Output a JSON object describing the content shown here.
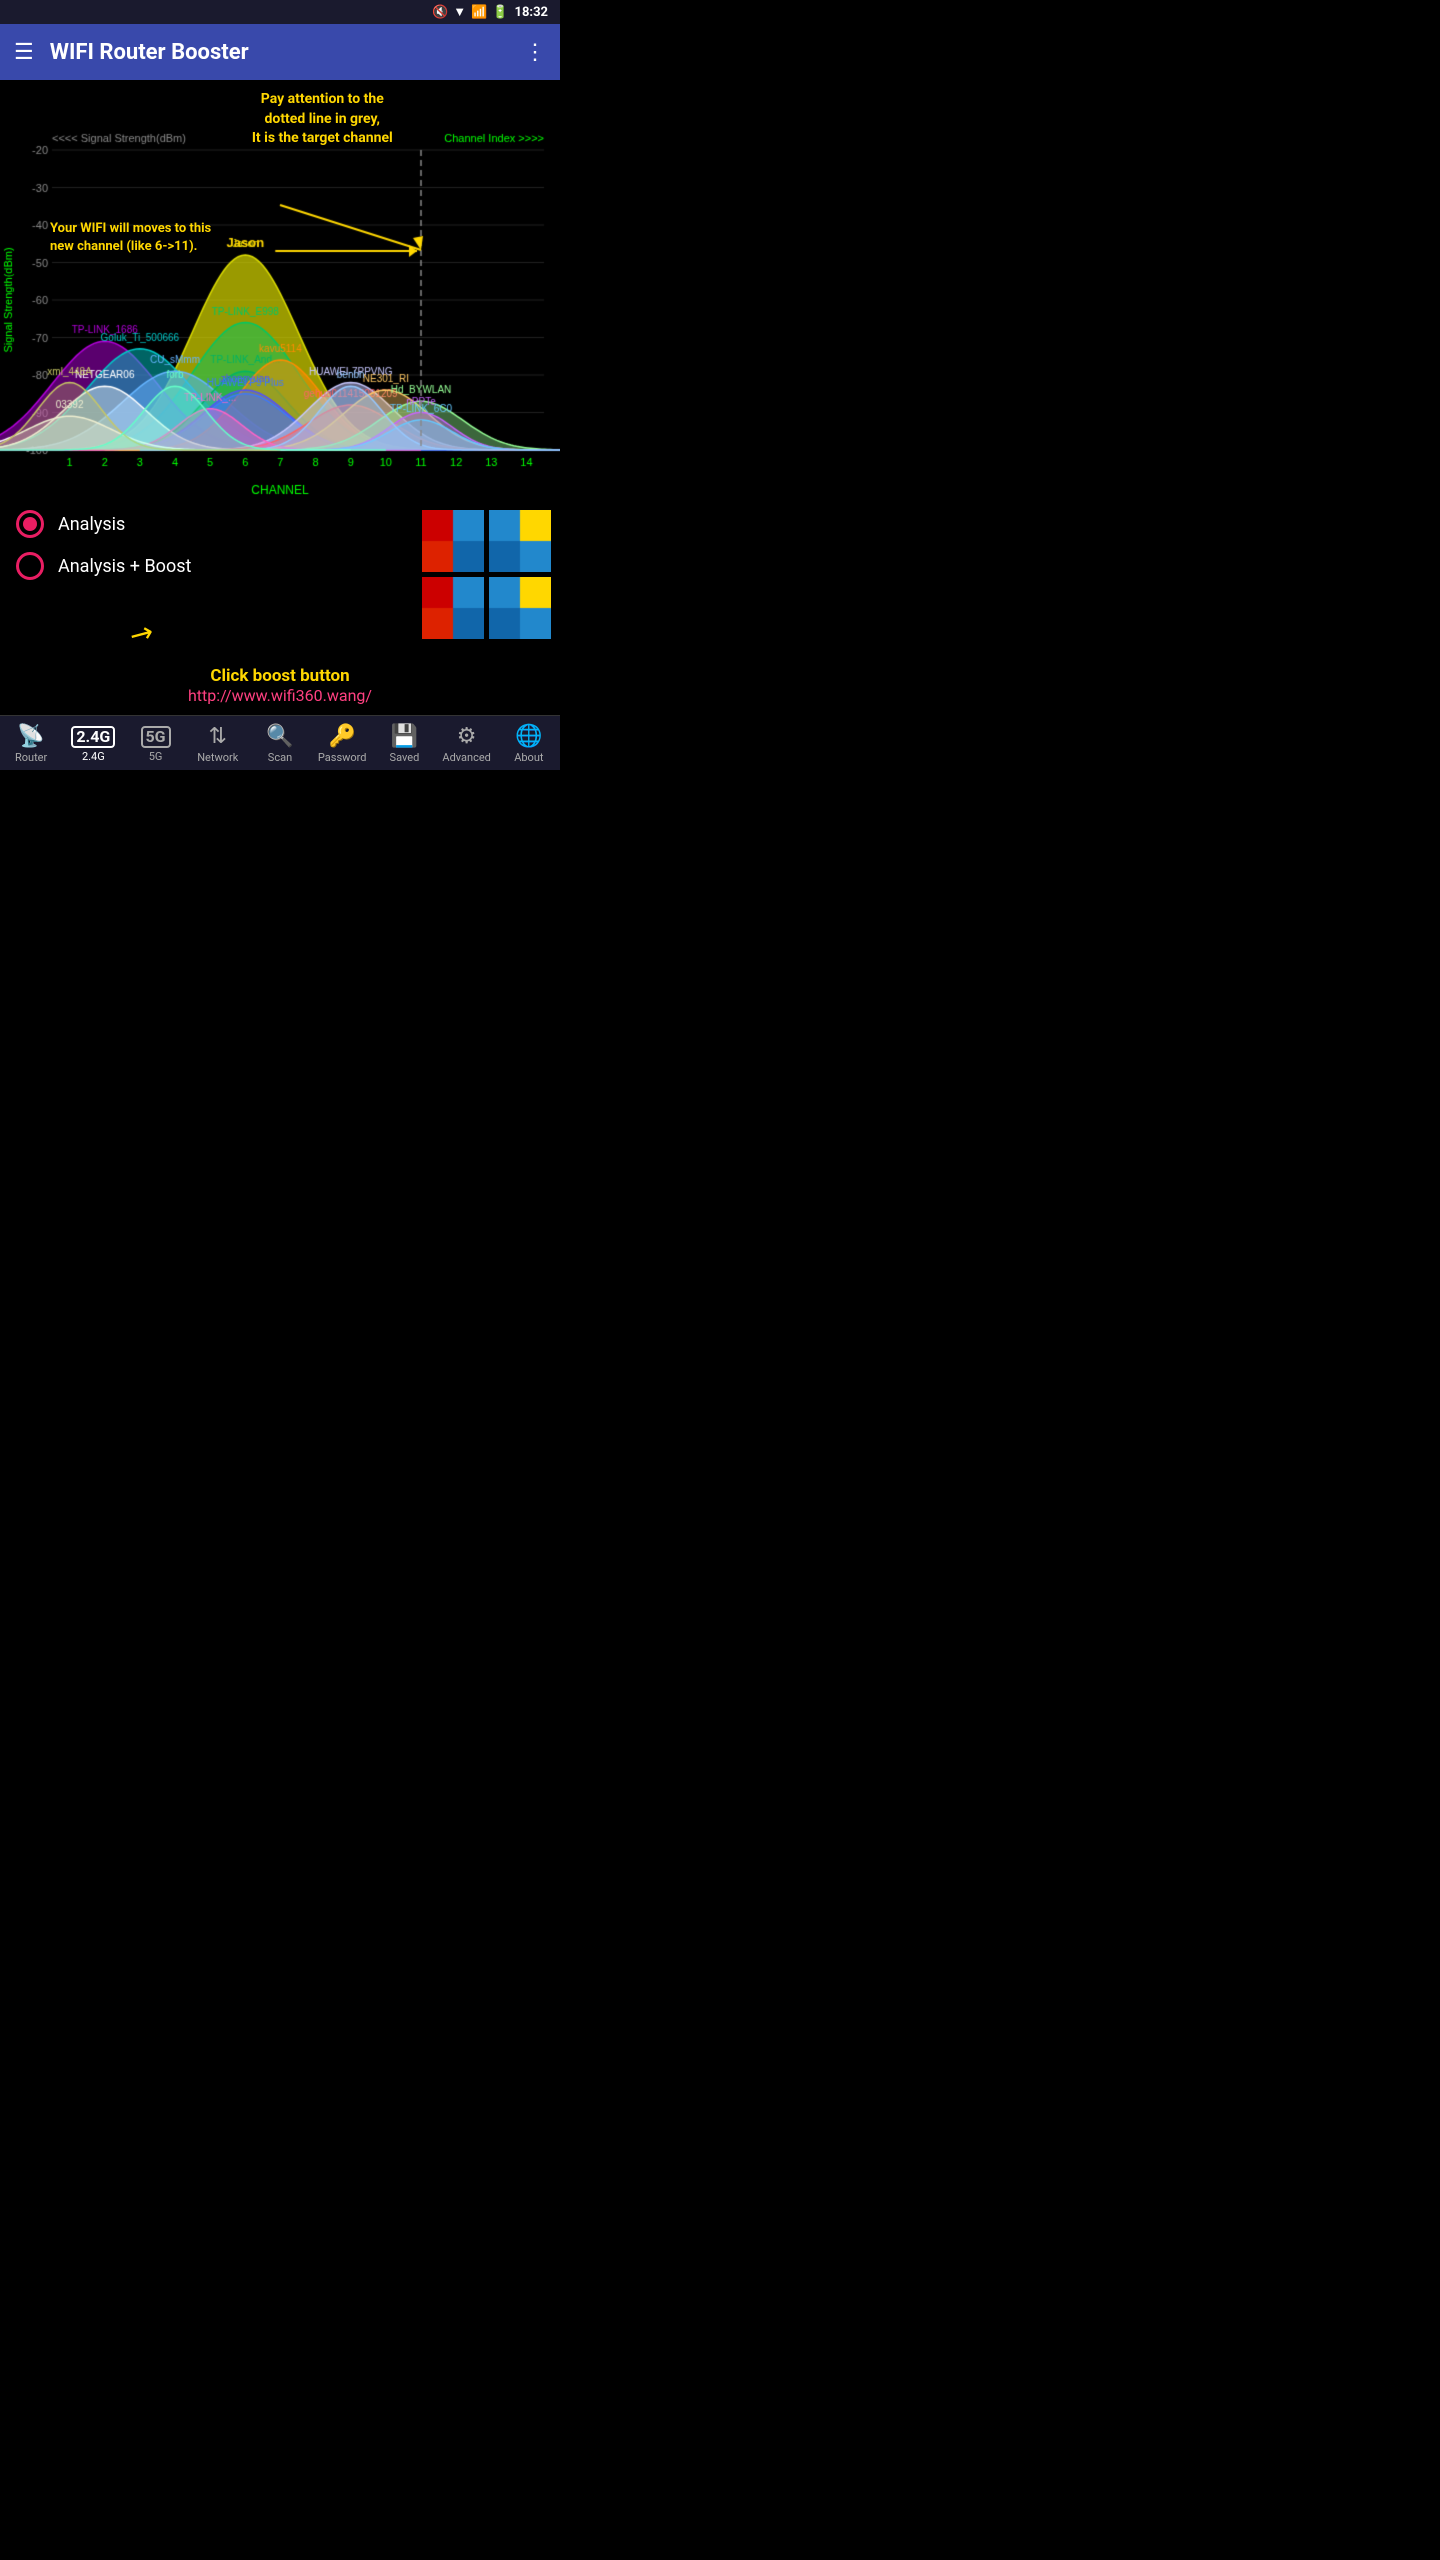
{
  "statusBar": {
    "time": "18:32"
  },
  "appBar": {
    "title": "WIFI Router Booster"
  },
  "annotations": {
    "top": "Pay attention to the\ndotted line in grey,\nIt is the target channel",
    "left": "Your WIFI will moves to this\nnew channel (like 6->11).",
    "bottom_click": "Click boost button",
    "bottom_link": "http://www.wifi360.wang/"
  },
  "chart": {
    "yLabel": "Signal Strength(dBm)",
    "xLabel": "CHANNEL",
    "yAxisLabel": "Signal Strength(dBm)",
    "xAxisLabel": "Channel Index >>>>",
    "yTicks": [
      -20,
      -30,
      -40,
      -50,
      -60,
      -70,
      -80,
      -90,
      -100
    ],
    "xTicks": [
      1,
      2,
      3,
      4,
      5,
      6,
      7,
      8,
      9,
      10,
      11,
      12,
      13,
      14
    ],
    "networks": [
      {
        "name": "Jason",
        "channel": 6,
        "strength": -48,
        "color": "rgba(220,220,0,0.7)",
        "width": 5
      },
      {
        "name": "TP-LINK_E998",
        "channel": 6,
        "strength": -66,
        "color": "rgba(0,200,100,0.5)",
        "width": 5
      },
      {
        "name": "TP-LINK_1686",
        "channel": 2,
        "strength": -71,
        "color": "rgba(180,0,220,0.5)",
        "width": 5
      },
      {
        "name": "Goluk_Ti_500666",
        "channel": 3,
        "strength": -73,
        "color": "rgba(0,200,200,0.5)",
        "width": 5
      },
      {
        "name": "CU_sMmm",
        "channel": 4,
        "strength": -79,
        "color": "rgba(100,180,255,0.5)",
        "width": 5
      },
      {
        "name": "TP-LINK_And...",
        "channel": 6,
        "strength": -79,
        "color": "rgba(0,180,100,0.4)",
        "width": 4
      },
      {
        "name": "kavu5114",
        "channel": 7,
        "strength": -76,
        "color": "rgba(255,140,0,0.5)",
        "width": 4
      },
      {
        "name": "zhangyuan",
        "channel": 6,
        "strength": -84,
        "color": "rgba(80,80,255,0.4)",
        "width": 4
      },
      {
        "name": "HUAWEI P9 Plus",
        "channel": 6,
        "strength": -85,
        "color": "rgba(60,120,255,0.4)",
        "width": 4
      },
      {
        "name": "NETGEAR06",
        "channel": 2,
        "strength": -83,
        "color": "rgba(255,255,255,0.4)",
        "width": 4
      },
      {
        "name": "HUAWEI-7PPVNG",
        "channel": 9,
        "strength": -82,
        "color": "rgba(200,200,255,0.5)",
        "width": 4
      },
      {
        "name": "gehua011415081209",
        "channel": 9,
        "strength": -88,
        "color": "rgba(255,100,100,0.4)",
        "width": 4
      },
      {
        "name": "NE301_RI",
        "channel": 10,
        "strength": -84,
        "color": "rgba(255,200,100,0.4)",
        "width": 4
      },
      {
        "name": "Hd_BYWLAN",
        "channel": 11,
        "strength": -87,
        "color": "rgba(150,255,150,0.4)",
        "width": 4
      },
      {
        "name": "TP-LINK_...",
        "channel": 5,
        "strength": -89,
        "color": "rgba(255,100,200,0.4)",
        "width": 3
      },
      {
        "name": "nPPTe",
        "channel": 11,
        "strength": -90,
        "color": "rgba(200,100,255,0.4)",
        "width": 3
      },
      {
        "name": "TP-LINK_6C0",
        "channel": 11,
        "strength": -92,
        "color": "rgba(100,200,255,0.4)",
        "width": 3
      },
      {
        "name": "03392",
        "channel": 1,
        "strength": -91,
        "color": "rgba(255,255,255,0.3)",
        "width": 4
      },
      {
        "name": "benbn",
        "channel": 9,
        "strength": -83,
        "color": "rgba(150,200,255,0.4)",
        "width": 3
      },
      {
        "name": "xml_448A",
        "channel": 1,
        "strength": -82,
        "color": "rgba(200,200,100,0.3)",
        "width": 3
      },
      {
        "name": "forb",
        "channel": 4,
        "strength": -83,
        "color": "rgba(100,255,200,0.3)",
        "width": 3
      }
    ],
    "targetChannel": 11
  },
  "radioOptions": [
    {
      "label": "Analysis",
      "selected": true
    },
    {
      "label": "Analysis + Boost",
      "selected": false
    }
  ],
  "bottomNav": {
    "items": [
      {
        "label": "Router",
        "icon": "router",
        "active": false
      },
      {
        "label": "2.4G",
        "icon": "2.4g",
        "active": true
      },
      {
        "label": "5G",
        "icon": "5g",
        "active": false
      },
      {
        "label": "Network",
        "icon": "network",
        "active": false
      },
      {
        "label": "Scan",
        "icon": "scan",
        "active": false
      },
      {
        "label": "Password",
        "icon": "password",
        "active": false
      },
      {
        "label": "Saved",
        "icon": "saved",
        "active": false
      },
      {
        "label": "Advanced",
        "icon": "advanced",
        "active": false
      },
      {
        "label": "About",
        "icon": "about",
        "active": false
      }
    ]
  }
}
